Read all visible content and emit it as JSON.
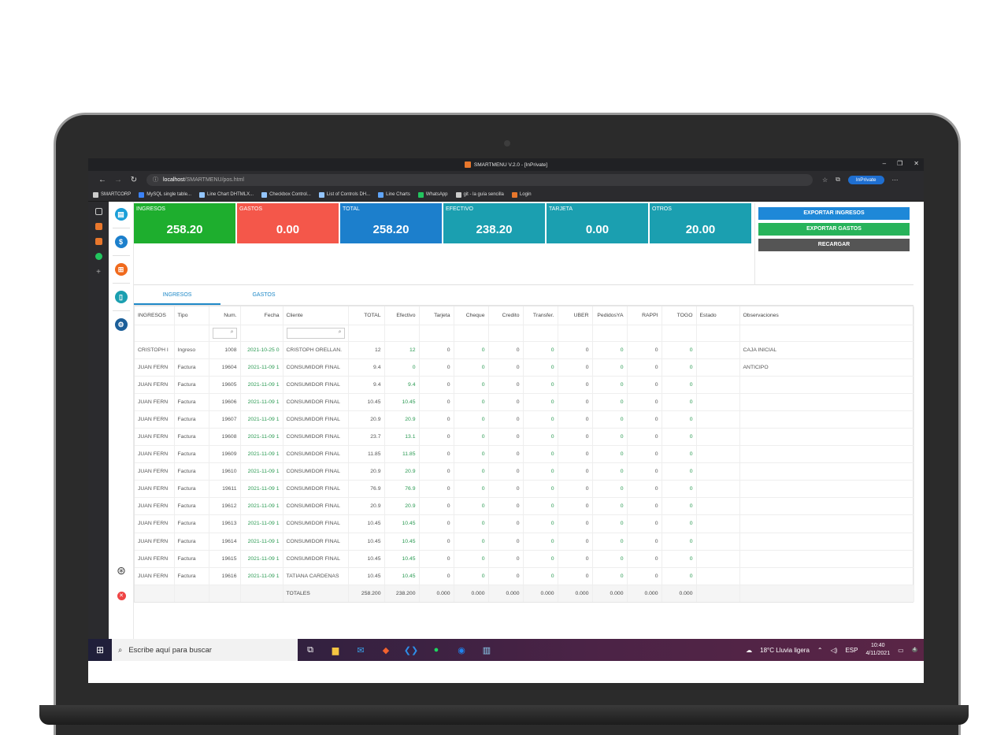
{
  "browser": {
    "window_title": "SMARTMENU V.2.0 - [InPrivate]",
    "url_host": "localhost",
    "url_path": "/SMARTMENU/pos.html",
    "inprivate_label": "InPrivate",
    "bookmarks": [
      {
        "label": "SMARTCORP",
        "color": "#cccccc"
      },
      {
        "label": "MySQL single table...",
        "color": "#3b82f6"
      },
      {
        "label": "Line Chart DHTMLX...",
        "color": "#93c5fd"
      },
      {
        "label": "Checkbox Control...",
        "color": "#93c5fd"
      },
      {
        "label": "List of Controls DH...",
        "color": "#93c5fd"
      },
      {
        "label": "Line Charts",
        "color": "#60a5fa"
      },
      {
        "label": "WhatsApp",
        "color": "#22c55e"
      },
      {
        "label": "git - la guía sencilla",
        "color": "#cccccc"
      },
      {
        "label": "Login",
        "color": "#e8772c"
      }
    ]
  },
  "cards": [
    {
      "label": "INGRESOS",
      "value": "258.20",
      "color": "#1eae2e"
    },
    {
      "label": "GASTOS",
      "value": "0.00",
      "color": "#f4574a"
    },
    {
      "label": "TOTAL",
      "value": "258.20",
      "color": "#1c7fcc"
    },
    {
      "label": "EFECTIVO",
      "value": "238.20",
      "color": "#1b9fb0"
    },
    {
      "label": "TARJETA",
      "value": "0.00",
      "color": "#1b9fb0"
    },
    {
      "label": "OTROS",
      "value": "20.00",
      "color": "#1b9fb0"
    }
  ],
  "actions": {
    "export_income": "EXPORTAR INGRESOS",
    "export_expenses": "EXPORTAR GASTOS",
    "reload": "RECARGAR"
  },
  "tabs": {
    "income": "INGRESOS",
    "expenses": "GASTOS"
  },
  "grid": {
    "columns": [
      "INGRESOS",
      "Tipo",
      "Num.",
      "Fecha",
      "Cliente",
      "TOTAL",
      "Efectivo",
      "Tarjeta",
      "Cheque",
      "Credito",
      "Transfer.",
      "UBER",
      "PedidosYA",
      "RAPPI",
      "TOGO",
      "Estado",
      "Observaciones"
    ],
    "rows": [
      [
        "CRISTOPH I",
        "Ingreso",
        "1008",
        "2021-10-25 0",
        "CRISTOPH ORELLAN.",
        "12",
        "12",
        "0",
        "0",
        "0",
        "0",
        "0",
        "0",
        "0",
        "0",
        "",
        "CAJA INICIAL"
      ],
      [
        "JUAN FERN",
        "Factura",
        "19604",
        "2021-11-09 1",
        "CONSUMIDOR FINAL",
        "9.4",
        "0",
        "0",
        "0",
        "0",
        "0",
        "0",
        "0",
        "0",
        "0",
        "",
        "ANTICIPO"
      ],
      [
        "JUAN FERN",
        "Factura",
        "19605",
        "2021-11-09 1",
        "CONSUMIDOR FINAL",
        "9.4",
        "9.4",
        "0",
        "0",
        "0",
        "0",
        "0",
        "0",
        "0",
        "0",
        "",
        ""
      ],
      [
        "JUAN FERN",
        "Factura",
        "19606",
        "2021-11-09 1",
        "CONSUMIDOR FINAL",
        "10.45",
        "10.45",
        "0",
        "0",
        "0",
        "0",
        "0",
        "0",
        "0",
        "0",
        "",
        ""
      ],
      [
        "JUAN FERN",
        "Factura",
        "19607",
        "2021-11-09 1",
        "CONSUMIDOR FINAL",
        "20.9",
        "20.9",
        "0",
        "0",
        "0",
        "0",
        "0",
        "0",
        "0",
        "0",
        "",
        ""
      ],
      [
        "JUAN FERN",
        "Factura",
        "19608",
        "2021-11-09 1",
        "CONSUMIDOR FINAL",
        "23.7",
        "13.1",
        "0",
        "0",
        "0",
        "0",
        "0",
        "0",
        "0",
        "0",
        "",
        ""
      ],
      [
        "JUAN FERN",
        "Factura",
        "19609",
        "2021-11-09 1",
        "CONSUMIDOR FINAL",
        "11.85",
        "11.85",
        "0",
        "0",
        "0",
        "0",
        "0",
        "0",
        "0",
        "0",
        "",
        ""
      ],
      [
        "JUAN FERN",
        "Factura",
        "19610",
        "2021-11-09 1",
        "CONSUMIDOR FINAL",
        "20.9",
        "20.9",
        "0",
        "0",
        "0",
        "0",
        "0",
        "0",
        "0",
        "0",
        "",
        ""
      ],
      [
        "JUAN FERN",
        "Factura",
        "19611",
        "2021-11-09 1",
        "CONSUMIDOR FINAL",
        "76.9",
        "76.9",
        "0",
        "0",
        "0",
        "0",
        "0",
        "0",
        "0",
        "0",
        "",
        ""
      ],
      [
        "JUAN FERN",
        "Factura",
        "19612",
        "2021-11-09 1",
        "CONSUMIDOR FINAL",
        "20.9",
        "20.9",
        "0",
        "0",
        "0",
        "0",
        "0",
        "0",
        "0",
        "0",
        "",
        ""
      ],
      [
        "JUAN FERN",
        "Factura",
        "19613",
        "2021-11-09 1",
        "CONSUMIDOR FINAL",
        "10.45",
        "10.45",
        "0",
        "0",
        "0",
        "0",
        "0",
        "0",
        "0",
        "0",
        "",
        ""
      ],
      [
        "JUAN FERN",
        "Factura",
        "19614",
        "2021-11-09 1",
        "CONSUMIDOR FINAL",
        "10.45",
        "10.45",
        "0",
        "0",
        "0",
        "0",
        "0",
        "0",
        "0",
        "0",
        "",
        ""
      ],
      [
        "JUAN FERN",
        "Factura",
        "19615",
        "2021-11-09 1",
        "CONSUMIDOR FINAL",
        "10.45",
        "10.45",
        "0",
        "0",
        "0",
        "0",
        "0",
        "0",
        "0",
        "0",
        "",
        ""
      ],
      [
        "JUAN FERN",
        "Factura",
        "19616",
        "2021-11-09 1",
        "TATIANA CARDENAS",
        "10.45",
        "10.45",
        "0",
        "0",
        "0",
        "0",
        "0",
        "0",
        "0",
        "0",
        "",
        ""
      ]
    ],
    "totals": [
      "",
      "",
      "",
      "",
      "TOTALES",
      "258.200",
      "238.200",
      "0.000",
      "0.000",
      "0.000",
      "0.000",
      "0.000",
      "0.000",
      "0.000",
      "0.000",
      "",
      ""
    ]
  },
  "taskbar": {
    "search_placeholder": "Escribe aquí para buscar",
    "weather": "18°C  Lluvia ligera",
    "language": "ESP",
    "time": "10:40",
    "date": "4/11/2021",
    "notifications": "4"
  }
}
